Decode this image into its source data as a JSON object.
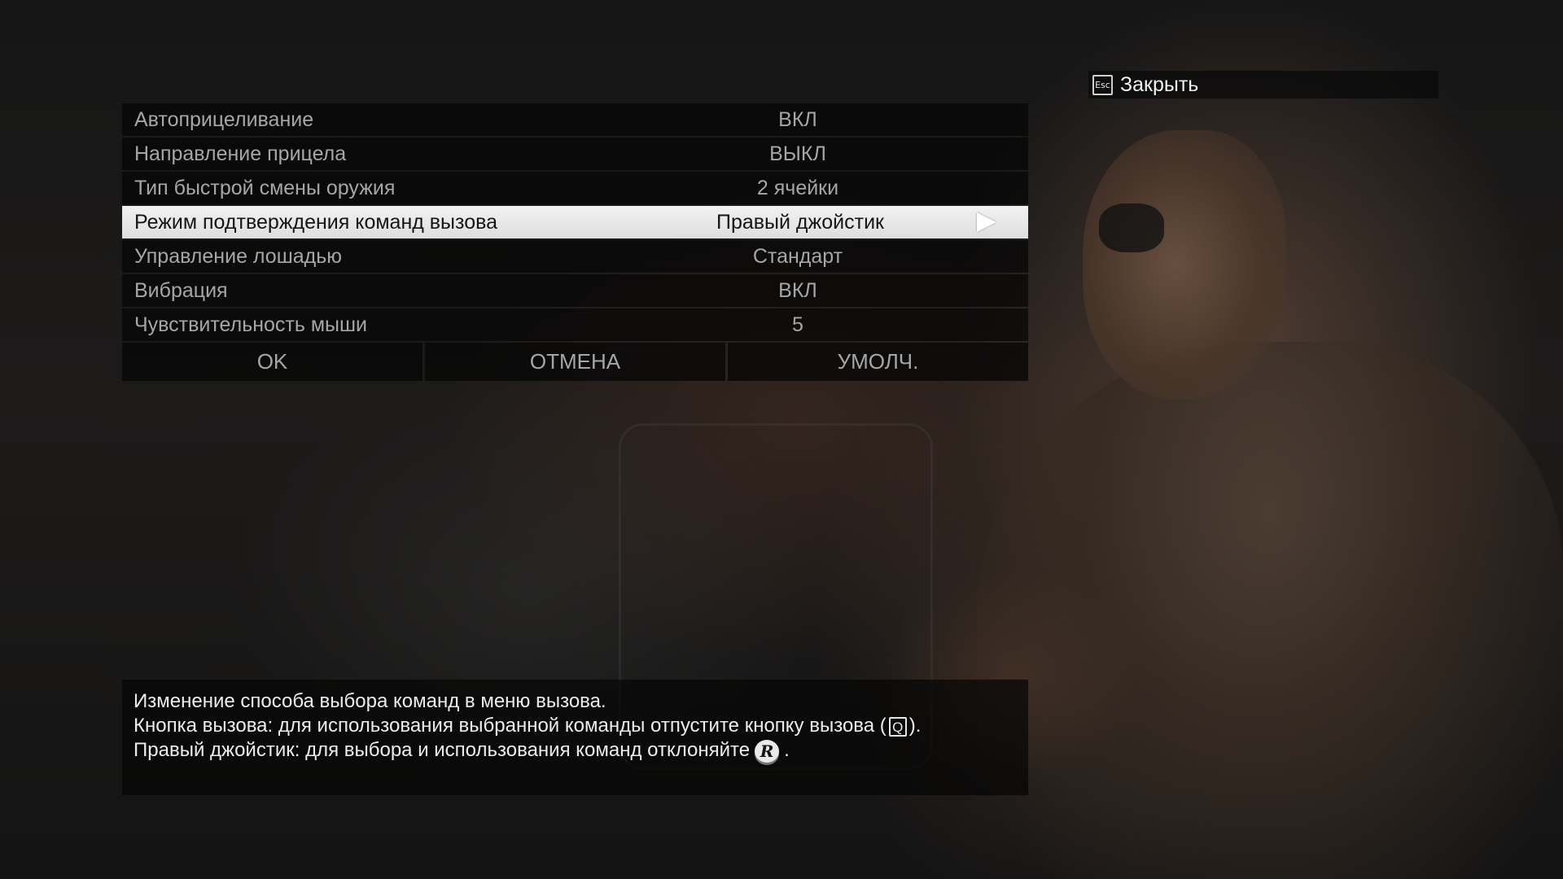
{
  "close": {
    "key": "Esc",
    "label": "Закрыть"
  },
  "settings": [
    {
      "label": "Автоприцеливание",
      "value": "ВКЛ",
      "selected": false
    },
    {
      "label": "Направление прицела",
      "value": "ВЫКЛ",
      "selected": false
    },
    {
      "label": "Тип быстрой смены оружия",
      "value": "2 ячейки",
      "selected": false
    },
    {
      "label": "Режим подтверждения команд вызова",
      "value": "Правый джойстик",
      "selected": true
    },
    {
      "label": "Управление лошадью",
      "value": "Стандарт",
      "selected": false
    },
    {
      "label": "Вибрация",
      "value": "ВКЛ",
      "selected": false
    },
    {
      "label": "Чувствительность мыши",
      "value": "5",
      "selected": false
    }
  ],
  "buttons": {
    "ok": "OK",
    "cancel": "ОТМЕНА",
    "default": "УМОЛЧ."
  },
  "description": {
    "line1": "Изменение способа выбора команд в меню вызова.",
    "line2_before": "Кнопка вызова: для использования выбранной команды отпустите кнопку вызова (",
    "line2_key": "Q",
    "line2_after": ").",
    "line3_before": "Правый джойстик: для выбора и использования команд отклоняйте",
    "line3_icon": "R",
    "line3_after": "."
  },
  "icons": {
    "selected_arrow": "arrow-right-icon",
    "stick": "right-stick-icon",
    "key": "keyboard-key-icon"
  }
}
